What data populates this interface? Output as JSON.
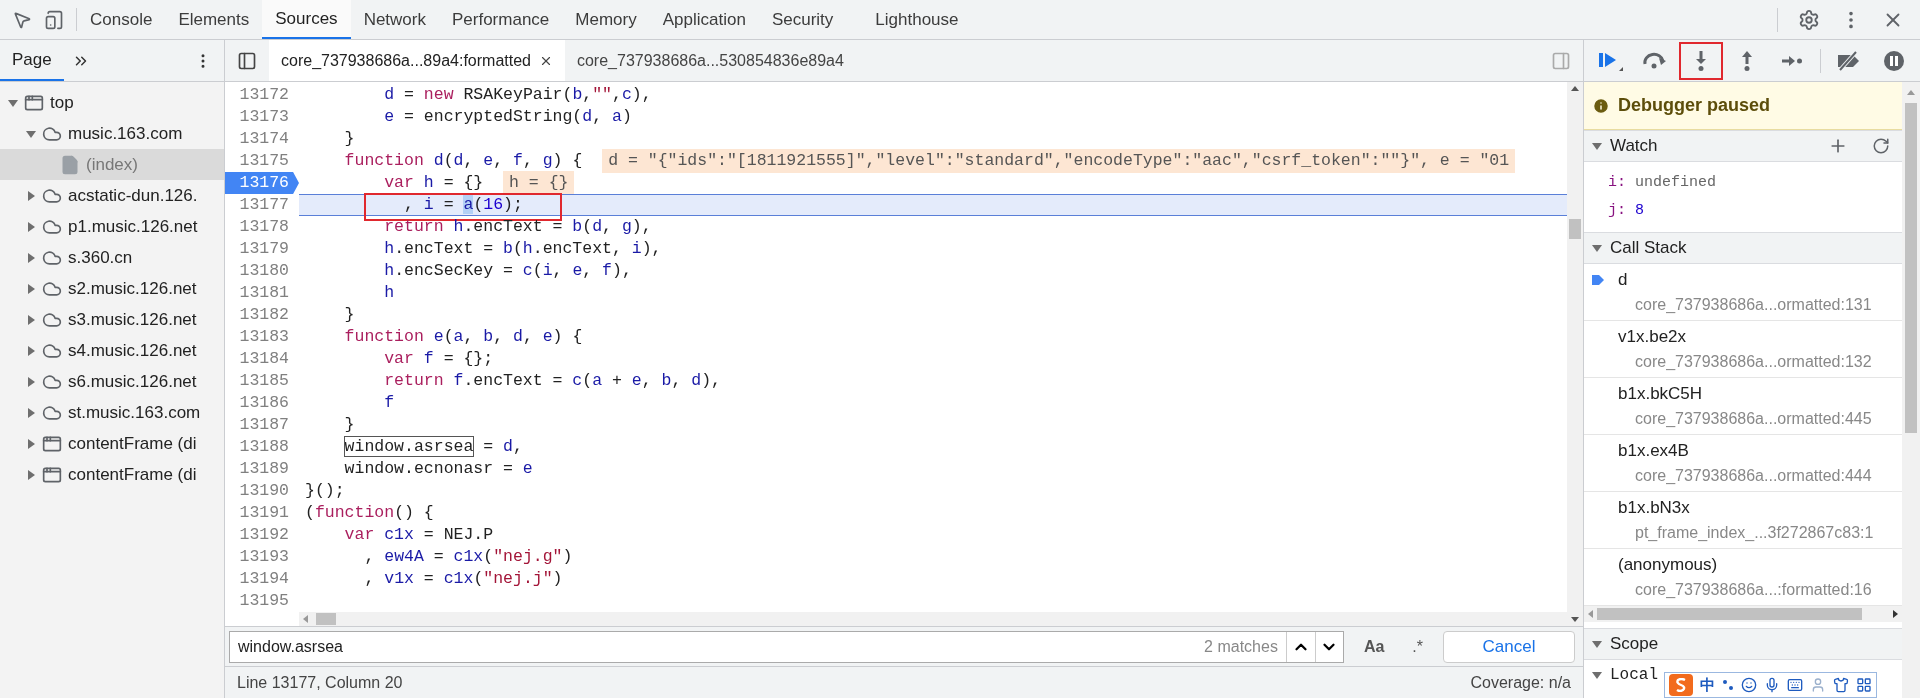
{
  "top_bar": {
    "tabs": [
      {
        "label": "Console",
        "selected": false
      },
      {
        "label": "Elements",
        "selected": false
      },
      {
        "label": "Sources",
        "selected": true
      },
      {
        "label": "Network",
        "selected": false
      },
      {
        "label": "Performance",
        "selected": false
      },
      {
        "label": "Memory",
        "selected": false
      },
      {
        "label": "Application",
        "selected": false
      },
      {
        "label": "Security",
        "selected": false
      },
      {
        "label": "Lighthouse",
        "selected": false
      }
    ]
  },
  "navigator": {
    "tabs": [
      {
        "label": "Page",
        "selected": true
      }
    ],
    "tree": [
      {
        "label": "top",
        "kind": "frame",
        "expanded": true,
        "selected": false,
        "children": [
          {
            "label": "music.163.com",
            "kind": "cloud",
            "expanded": true,
            "selected": false,
            "children": [
              {
                "label": "(index)",
                "kind": "file",
                "selected": true
              }
            ]
          },
          {
            "label": "acstatic-dun.126.",
            "kind": "cloud",
            "expanded": false,
            "selected": false
          },
          {
            "label": "p1.music.126.net",
            "kind": "cloud",
            "expanded": false,
            "selected": false
          },
          {
            "label": "s.360.cn",
            "kind": "cloud",
            "expanded": false,
            "selected": false
          },
          {
            "label": "s2.music.126.net",
            "kind": "cloud",
            "expanded": false,
            "selected": false
          },
          {
            "label": "s3.music.126.net",
            "kind": "cloud",
            "expanded": false,
            "selected": false
          },
          {
            "label": "s4.music.126.net",
            "kind": "cloud",
            "expanded": false,
            "selected": false
          },
          {
            "label": "s6.music.126.net",
            "kind": "cloud",
            "expanded": false,
            "selected": false
          },
          {
            "label": "st.music.163.com",
            "kind": "cloud",
            "expanded": false,
            "selected": false
          },
          {
            "label": "contentFrame (di",
            "kind": "frame",
            "expanded": false,
            "selected": false
          },
          {
            "label": "contentFrame (di",
            "kind": "frame",
            "expanded": false,
            "selected": false
          }
        ]
      }
    ]
  },
  "editor": {
    "tabs": [
      {
        "label": "core_737938686a...89a4:formatted",
        "selected": true,
        "closable": true
      },
      {
        "label": "core_737938686a...530854836e89a4",
        "selected": false,
        "closable": false
      }
    ],
    "lines": [
      {
        "number": "13172",
        "breakpoint": false,
        "current": false,
        "boxed": false,
        "tokens": [
          {
            "kind": "name",
            "text": "        d"
          },
          {
            "kind": "plain",
            "text": " = "
          },
          {
            "kind": "keyword",
            "text": "new"
          },
          {
            "kind": "plain",
            "text": " RSAKeyPair("
          },
          {
            "kind": "name",
            "text": "b"
          },
          {
            "kind": "plain",
            "text": ","
          },
          {
            "kind": "string",
            "text": "\"\""
          },
          {
            "kind": "plain",
            "text": ","
          },
          {
            "kind": "name",
            "text": "c"
          },
          {
            "kind": "plain",
            "text": "),"
          }
        ]
      },
      {
        "number": "13173",
        "breakpoint": false,
        "current": false,
        "boxed": false,
        "tokens": [
          {
            "kind": "name",
            "text": "        e"
          },
          {
            "kind": "plain",
            "text": " = encryptedString("
          },
          {
            "kind": "name",
            "text": "d"
          },
          {
            "kind": "plain",
            "text": ", "
          },
          {
            "kind": "name",
            "text": "a"
          },
          {
            "kind": "plain",
            "text": ")"
          }
        ]
      },
      {
        "number": "13174",
        "breakpoint": false,
        "current": false,
        "boxed": false,
        "tokens": [
          {
            "kind": "plain",
            "text": "    }"
          }
        ]
      },
      {
        "number": "13175",
        "breakpoint": false,
        "current": false,
        "boxed": false,
        "tokens": [
          {
            "kind": "keyword",
            "text": "    function "
          },
          {
            "kind": "name",
            "text": "d"
          },
          {
            "kind": "plain",
            "text": "("
          },
          {
            "kind": "name",
            "text": "d"
          },
          {
            "kind": "plain",
            "text": ", "
          },
          {
            "kind": "name",
            "text": "e"
          },
          {
            "kind": "plain",
            "text": ", "
          },
          {
            "kind": "name",
            "text": "f"
          },
          {
            "kind": "plain",
            "text": ", "
          },
          {
            "kind": "name",
            "text": "g"
          },
          {
            "kind": "plain",
            "text": ") {"
          }
        ],
        "inline_value": "d = \"{\"ids\":\"[1811921555]\",\"level\":\"standard\",\"encodeType\":\"aac\",\"csrf_token\":\"\"}\", e = \"01"
      },
      {
        "number": "13176",
        "breakpoint": true,
        "current": false,
        "boxed": false,
        "tokens": [
          {
            "kind": "keyword",
            "text": "        var "
          },
          {
            "kind": "name",
            "text": "h"
          },
          {
            "kind": "plain",
            "text": " = {}"
          }
        ],
        "inline_value": "h = {}"
      },
      {
        "number": "13177",
        "breakpoint": false,
        "current": true,
        "boxed": true,
        "tokens": [
          {
            "kind": "plain",
            "text": "          , "
          },
          {
            "kind": "name",
            "text": "i"
          },
          {
            "kind": "plain",
            "text": " = "
          },
          {
            "kind": "selection",
            "text": "a"
          },
          {
            "kind": "plain",
            "text": "("
          },
          {
            "kind": "number",
            "text": "16"
          },
          {
            "kind": "plain",
            "text": ");"
          }
        ]
      },
      {
        "number": "13178",
        "breakpoint": false,
        "current": false,
        "boxed": false,
        "tokens": [
          {
            "kind": "keyword",
            "text": "        return "
          },
          {
            "kind": "name",
            "text": "h"
          },
          {
            "kind": "plain",
            "text": ".encText = "
          },
          {
            "kind": "name",
            "text": "b"
          },
          {
            "kind": "plain",
            "text": "("
          },
          {
            "kind": "name",
            "text": "d"
          },
          {
            "kind": "plain",
            "text": ", "
          },
          {
            "kind": "name",
            "text": "g"
          },
          {
            "kind": "plain",
            "text": "),"
          }
        ]
      },
      {
        "number": "13179",
        "breakpoint": false,
        "current": false,
        "boxed": false,
        "tokens": [
          {
            "kind": "name",
            "text": "        h"
          },
          {
            "kind": "plain",
            "text": ".encText = "
          },
          {
            "kind": "name",
            "text": "b"
          },
          {
            "kind": "plain",
            "text": "("
          },
          {
            "kind": "name",
            "text": "h"
          },
          {
            "kind": "plain",
            "text": ".encText, "
          },
          {
            "kind": "name",
            "text": "i"
          },
          {
            "kind": "plain",
            "text": "),"
          }
        ]
      },
      {
        "number": "13180",
        "breakpoint": false,
        "current": false,
        "boxed": false,
        "tokens": [
          {
            "kind": "name",
            "text": "        h"
          },
          {
            "kind": "plain",
            "text": ".encSecKey = "
          },
          {
            "kind": "name",
            "text": "c"
          },
          {
            "kind": "plain",
            "text": "("
          },
          {
            "kind": "name",
            "text": "i"
          },
          {
            "kind": "plain",
            "text": ", "
          },
          {
            "kind": "name",
            "text": "e"
          },
          {
            "kind": "plain",
            "text": ", "
          },
          {
            "kind": "name",
            "text": "f"
          },
          {
            "kind": "plain",
            "text": "),"
          }
        ]
      },
      {
        "number": "13181",
        "breakpoint": false,
        "current": false,
        "boxed": false,
        "tokens": [
          {
            "kind": "name",
            "text": "        h"
          }
        ]
      },
      {
        "number": "13182",
        "breakpoint": false,
        "current": false,
        "boxed": false,
        "tokens": [
          {
            "kind": "plain",
            "text": "    }"
          }
        ]
      },
      {
        "number": "13183",
        "breakpoint": false,
        "current": false,
        "boxed": false,
        "tokens": [
          {
            "kind": "keyword",
            "text": "    function "
          },
          {
            "kind": "name",
            "text": "e"
          },
          {
            "kind": "plain",
            "text": "("
          },
          {
            "kind": "name",
            "text": "a"
          },
          {
            "kind": "plain",
            "text": ", "
          },
          {
            "kind": "name",
            "text": "b"
          },
          {
            "kind": "plain",
            "text": ", "
          },
          {
            "kind": "name",
            "text": "d"
          },
          {
            "kind": "plain",
            "text": ", "
          },
          {
            "kind": "name",
            "text": "e"
          },
          {
            "kind": "plain",
            "text": ") {"
          }
        ]
      },
      {
        "number": "13184",
        "breakpoint": false,
        "current": false,
        "boxed": false,
        "tokens": [
          {
            "kind": "keyword",
            "text": "        var "
          },
          {
            "kind": "name",
            "text": "f"
          },
          {
            "kind": "plain",
            "text": " = {};"
          }
        ]
      },
      {
        "number": "13185",
        "breakpoint": false,
        "current": false,
        "boxed": false,
        "tokens": [
          {
            "kind": "keyword",
            "text": "        return "
          },
          {
            "kind": "name",
            "text": "f"
          },
          {
            "kind": "plain",
            "text": ".encText = "
          },
          {
            "kind": "name",
            "text": "c"
          },
          {
            "kind": "plain",
            "text": "("
          },
          {
            "kind": "name",
            "text": "a"
          },
          {
            "kind": "plain",
            "text": " + "
          },
          {
            "kind": "name",
            "text": "e"
          },
          {
            "kind": "plain",
            "text": ", "
          },
          {
            "kind": "name",
            "text": "b"
          },
          {
            "kind": "plain",
            "text": ", "
          },
          {
            "kind": "name",
            "text": "d"
          },
          {
            "kind": "plain",
            "text": "),"
          }
        ]
      },
      {
        "number": "13186",
        "breakpoint": false,
        "current": false,
        "boxed": false,
        "tokens": [
          {
            "kind": "name",
            "text": "        f"
          }
        ]
      },
      {
        "number": "13187",
        "breakpoint": false,
        "current": false,
        "boxed": false,
        "tokens": [
          {
            "kind": "plain",
            "text": "    }"
          }
        ]
      },
      {
        "number": "13188",
        "breakpoint": false,
        "current": false,
        "boxed": false,
        "tokens": [
          {
            "kind": "match",
            "text": "    window.asrsea"
          },
          {
            "kind": "plain",
            "text": " = "
          },
          {
            "kind": "name",
            "text": "d"
          },
          {
            "kind": "plain",
            "text": ","
          }
        ]
      },
      {
        "number": "13189",
        "breakpoint": false,
        "current": false,
        "boxed": false,
        "tokens": [
          {
            "kind": "plain",
            "text": "    window.ecnonasr = "
          },
          {
            "kind": "name",
            "text": "e"
          }
        ]
      },
      {
        "number": "13190",
        "breakpoint": false,
        "current": false,
        "boxed": false,
        "tokens": [
          {
            "kind": "plain",
            "text": "}();"
          }
        ]
      },
      {
        "number": "13191",
        "breakpoint": false,
        "current": false,
        "boxed": false,
        "tokens": [
          {
            "kind": "plain",
            "text": "("
          },
          {
            "kind": "keyword",
            "text": "function"
          },
          {
            "kind": "plain",
            "text": "() {"
          }
        ]
      },
      {
        "number": "13192",
        "breakpoint": false,
        "current": false,
        "boxed": false,
        "tokens": [
          {
            "kind": "keyword",
            "text": "    var "
          },
          {
            "kind": "name",
            "text": "c1x"
          },
          {
            "kind": "plain",
            "text": " = NEJ.P"
          }
        ]
      },
      {
        "number": "13193",
        "breakpoint": false,
        "current": false,
        "boxed": false,
        "tokens": [
          {
            "kind": "plain",
            "text": "      , "
          },
          {
            "kind": "name",
            "text": "ew4A"
          },
          {
            "kind": "plain",
            "text": " = "
          },
          {
            "kind": "name",
            "text": "c1x"
          },
          {
            "kind": "plain",
            "text": "("
          },
          {
            "kind": "string",
            "text": "\"nej.g\""
          },
          {
            "kind": "plain",
            "text": ")"
          }
        ]
      },
      {
        "number": "13194",
        "breakpoint": false,
        "current": false,
        "boxed": false,
        "tokens": [
          {
            "kind": "plain",
            "text": "      , "
          },
          {
            "kind": "name",
            "text": "v1x"
          },
          {
            "kind": "plain",
            "text": " = "
          },
          {
            "kind": "name",
            "text": "c1x"
          },
          {
            "kind": "plain",
            "text": "("
          },
          {
            "kind": "string",
            "text": "\"nej.j\""
          },
          {
            "kind": "plain",
            "text": ")"
          }
        ]
      },
      {
        "number": "13195",
        "breakpoint": false,
        "current": false,
        "boxed": false
      }
    ],
    "search": {
      "value": "window.asrsea",
      "matches": "2 matches",
      "case_toggle": "Aa",
      "regex_toggle": ".*",
      "cancel": "Cancel"
    },
    "status_bar": {
      "position": "Line 13177, Column 20",
      "coverage": "Coverage: n/a"
    }
  },
  "debugger": {
    "controls": [
      {
        "kind": "resume",
        "boxed": false
      },
      {
        "kind": "step-over",
        "boxed": false
      },
      {
        "kind": "step-into",
        "boxed": true
      },
      {
        "kind": "step-out",
        "boxed": false
      },
      {
        "kind": "step",
        "boxed": false
      },
      {
        "kind": "deactivate",
        "boxed": false
      },
      {
        "kind": "pause-exceptions",
        "boxed": false
      }
    ],
    "banner": "Debugger paused",
    "watch": {
      "title": "Watch",
      "expanded": true,
      "entries": [
        {
          "name": "i:",
          "value": "undefined",
          "kind": "undefined"
        },
        {
          "name": "j:",
          "value": "8",
          "kind": "number"
        }
      ]
    },
    "call_stack": {
      "title": "Call Stack",
      "expanded": true,
      "frames": [
        {
          "name": "d",
          "location": "core_737938686a...ormatted:131",
          "selected": true
        },
        {
          "name": "v1x.be2x",
          "location": "core_737938686a...ormatted:132",
          "selected": false
        },
        {
          "name": "b1x.bkC5H",
          "location": "core_737938686a...ormatted:445",
          "selected": false
        },
        {
          "name": "b1x.ex4B",
          "location": "core_737938686a...ormatted:444",
          "selected": false
        },
        {
          "name": "b1x.bN3x",
          "location": "pt_frame_index_...3f272867c83:1",
          "selected": false
        },
        {
          "name": "(anonymous)",
          "location": "core_737938686a...:formatted:16",
          "selected": false
        }
      ]
    },
    "scope": {
      "title": "Scope",
      "expanded": true,
      "children": [
        {
          "label": "Local",
          "expanded": true
        }
      ]
    }
  },
  "ime_toolbar": {
    "mode": "中"
  }
}
